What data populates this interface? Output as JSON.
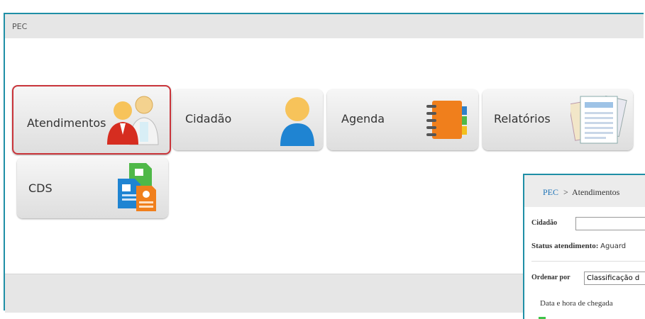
{
  "app": {
    "title": "PEC"
  },
  "tiles": {
    "atendimentos": {
      "label": "Atendimentos",
      "icon": "people-icon"
    },
    "cidadao": {
      "label": "Cidadão",
      "icon": "person-icon"
    },
    "agenda": {
      "label": "Agenda",
      "icon": "agenda-book-icon"
    },
    "relatorios": {
      "label": "Relatórios",
      "icon": "reports-icon"
    },
    "cds": {
      "label": "CDS",
      "icon": "documents-icon"
    }
  },
  "panel": {
    "breadcrumb_root": "PEC",
    "breadcrumb_sep": ">",
    "breadcrumb_current": "Atendimentos",
    "cidadao_label": "Cidadão",
    "cidadao_value": "",
    "status_label": "Status atendimento:",
    "status_value": "Aguard",
    "ordenar_label": "Ordenar por",
    "ordenar_value": "Classificação d",
    "column_header": "Data e hora de chegada"
  },
  "colors": {
    "accent": "#1f8fa6",
    "selected_border": "#c9343a",
    "link": "#1f74b7"
  }
}
